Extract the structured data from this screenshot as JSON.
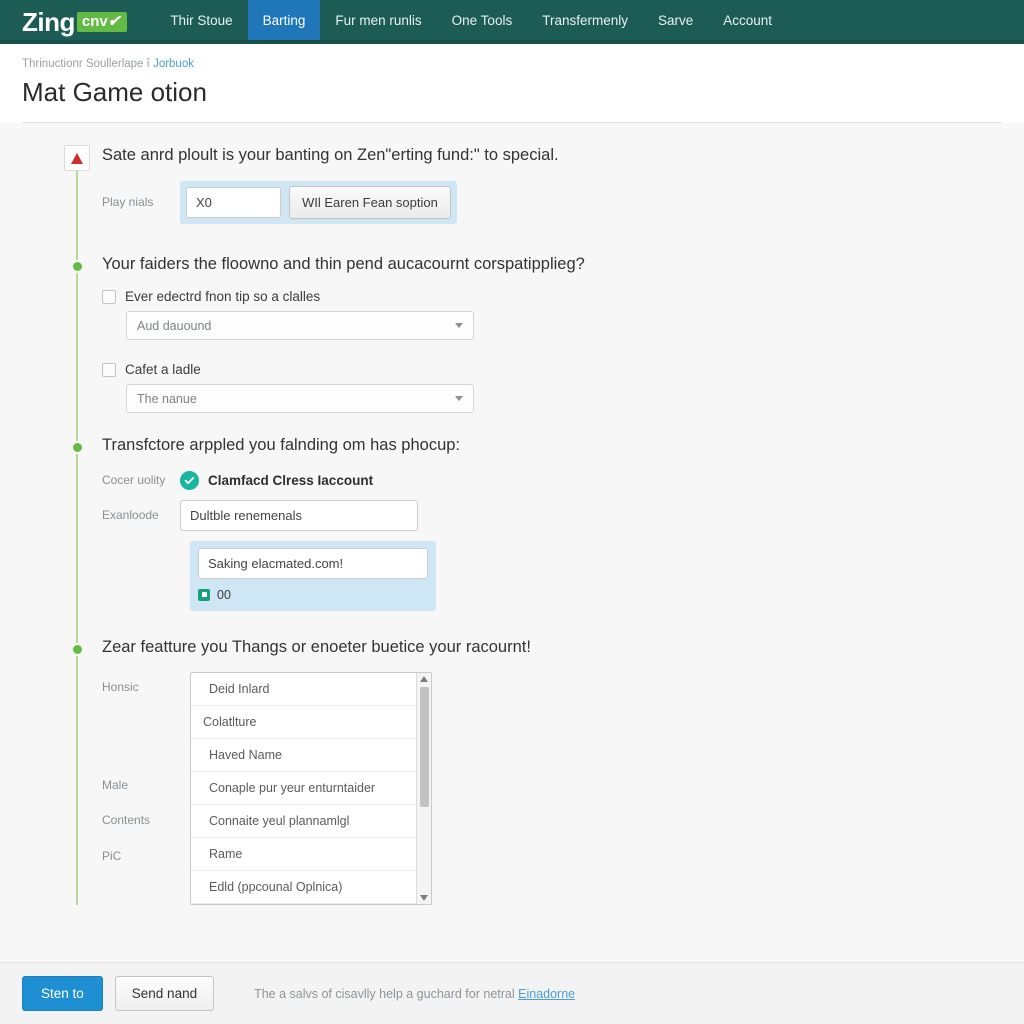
{
  "header": {
    "brand": {
      "word": "Zing",
      "badge": "cnv",
      "badge_tick": "✔"
    },
    "nav": [
      {
        "label": "Thir Stoue",
        "active": false
      },
      {
        "label": "Barting",
        "active": true
      },
      {
        "label": "Fur men runlis",
        "active": false
      },
      {
        "label": "One Tools",
        "active": false
      },
      {
        "label": "Transfermenly",
        "active": false
      },
      {
        "label": "Sarve",
        "active": false
      },
      {
        "label": "Account",
        "active": false
      }
    ],
    "active_color": "#1f76b8",
    "bar_color": "#1d5c55"
  },
  "breadcrumb": {
    "text": "Thrinuctionr Soullerlape",
    "sep": "î",
    "link": "Jorbuok"
  },
  "page_title": "Mat Game otion",
  "steps": [
    {
      "marker": "warning-icon",
      "heading": "Sate anrd ploult is your banting on Zen\"erting fund:\" to special.",
      "field_label": "Play nials",
      "input_value": "X0",
      "button_label": "WIl Earen Fean soption"
    },
    {
      "marker": "green-dot",
      "heading": "Your faiders the floowno and thin pend aucacournt corspatipplieg?",
      "checks": [
        {
          "label": "Ever edectrd fnon tip so a clalles",
          "checked": false,
          "select_value": "Aud dauound"
        },
        {
          "label": "Cafet a ladle",
          "checked": false,
          "select_value": "The nanue"
        }
      ]
    },
    {
      "marker": "green-dot",
      "heading": "Transfctore arppled you falnding om has phocup:",
      "label_1": "Cocer uolity",
      "confirm_text": "Clamfacd Clress Iaccount",
      "label_2": "Exanloode",
      "input_1": "Dultble renemenals",
      "input_2": "Saking elacmated.com!",
      "mini_value": "00"
    },
    {
      "marker": "green-dot",
      "heading": "Zear featture you Thangs or enoeter buetice your racournt!",
      "side_labels": [
        "Honsic",
        "Male",
        "Contents",
        "PiC"
      ],
      "options": [
        "Deid Inlard",
        "Colatlture",
        "Haved Name",
        "Conaple pur yeur enturntaider",
        "Connaite yeul plannamlgl",
        "Rame",
        "Edld (ppcounal Oplnica)"
      ]
    }
  ],
  "footer": {
    "primary": "Sten to",
    "secondary": "Send nand",
    "note": "The a salvs of cisavlly help a guchard for netral ",
    "note_link": "Einadorne"
  }
}
